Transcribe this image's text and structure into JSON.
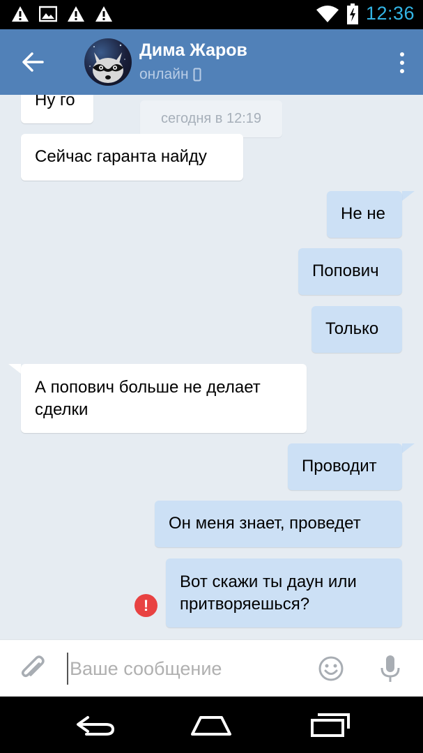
{
  "status_bar": {
    "time": "12:36",
    "left_icons": [
      "warning-icon",
      "image-icon",
      "warning-icon",
      "warning-icon"
    ],
    "right_icons": [
      "wifi-icon",
      "battery-charging-icon"
    ],
    "clock_color": "#33b5e5"
  },
  "header": {
    "contact_name": "Дима Жаров",
    "status": "онлайн",
    "status_icon": "mobile-phone-icon",
    "background_color": "#5181b8"
  },
  "chat": {
    "date_separator": "сегодня в 12:19",
    "messages": [
      {
        "direction": "in",
        "text": "Ну го"
      },
      {
        "direction": "in",
        "text": "Сейчас гаранта найду"
      },
      {
        "direction": "out",
        "text": "Не не"
      },
      {
        "direction": "out",
        "text": "Попович"
      },
      {
        "direction": "out",
        "text": "Только"
      },
      {
        "direction": "in",
        "line1": "А попович больше не делает",
        "line2": "сделки"
      },
      {
        "direction": "out",
        "text": "Проводит"
      },
      {
        "direction": "out",
        "text": "Он меня знает, проведет"
      },
      {
        "direction": "out",
        "line1": "Вот скажи ты даун или",
        "line2": "притворяешься?",
        "status": "error"
      }
    ],
    "incoming_bubble_color": "#ffffff",
    "outgoing_bubble_color": "#cce0f5",
    "error_color": "#e84242"
  },
  "input_bar": {
    "placeholder": "Ваше сообщение",
    "value": ""
  },
  "nav_bar": {
    "buttons": [
      "back-icon",
      "home-icon",
      "recents-icon"
    ]
  }
}
